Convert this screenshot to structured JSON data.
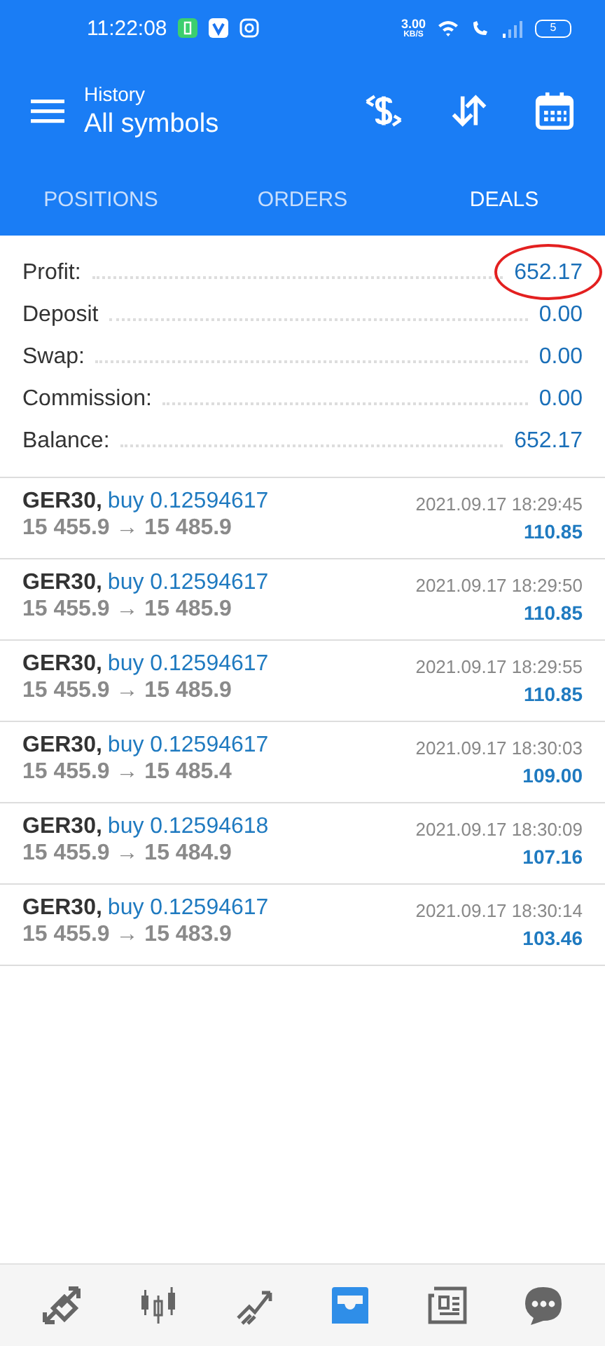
{
  "status_bar": {
    "time": "11:22:08",
    "speed": "3.00",
    "speed_unit": "KB/S",
    "battery": "5"
  },
  "header": {
    "subtitle": "History",
    "title": "All symbols"
  },
  "tabs": [
    {
      "label": "POSITIONS",
      "selected": false
    },
    {
      "label": "ORDERS",
      "selected": false
    },
    {
      "label": "DEALS",
      "selected": true
    }
  ],
  "summary": [
    {
      "label": "Profit:",
      "value": "652.17",
      "circled": true
    },
    {
      "label": "Deposit",
      "value": "0.00",
      "circled": false
    },
    {
      "label": "Swap:",
      "value": "0.00",
      "circled": false
    },
    {
      "label": "Commission:",
      "value": "0.00",
      "circled": false
    },
    {
      "label": "Balance:",
      "value": "652.17",
      "circled": false
    }
  ],
  "deals": [
    {
      "symbol": "GER30,",
      "side": "buy 0.12594617",
      "prices": "15 455.9 → 15 485.9",
      "time": "2021.09.17 18:29:45",
      "profit": "110.85"
    },
    {
      "symbol": "GER30,",
      "side": "buy 0.12594617",
      "prices": "15 455.9 → 15 485.9",
      "time": "2021.09.17 18:29:50",
      "profit": "110.85"
    },
    {
      "symbol": "GER30,",
      "side": "buy 0.12594617",
      "prices": "15 455.9 → 15 485.9",
      "time": "2021.09.17 18:29:55",
      "profit": "110.85"
    },
    {
      "symbol": "GER30,",
      "side": "buy 0.12594617",
      "prices": "15 455.9 → 15 485.4",
      "time": "2021.09.17 18:30:03",
      "profit": "109.00"
    },
    {
      "symbol": "GER30,",
      "side": "buy 0.12594618",
      "prices": "15 455.9 → 15 484.9",
      "time": "2021.09.17 18:30:09",
      "profit": "107.16"
    },
    {
      "symbol": "GER30,",
      "side": "buy 0.12594617",
      "prices": "15 455.9 → 15 483.9",
      "time": "2021.09.17 18:30:14",
      "profit": "103.46"
    }
  ],
  "nav": [
    {
      "kind": "trade",
      "selected": false
    },
    {
      "kind": "chart",
      "selected": false
    },
    {
      "kind": "quotes",
      "selected": false
    },
    {
      "kind": "history",
      "selected": true
    },
    {
      "kind": "news",
      "selected": false
    },
    {
      "kind": "chat",
      "selected": false
    }
  ]
}
